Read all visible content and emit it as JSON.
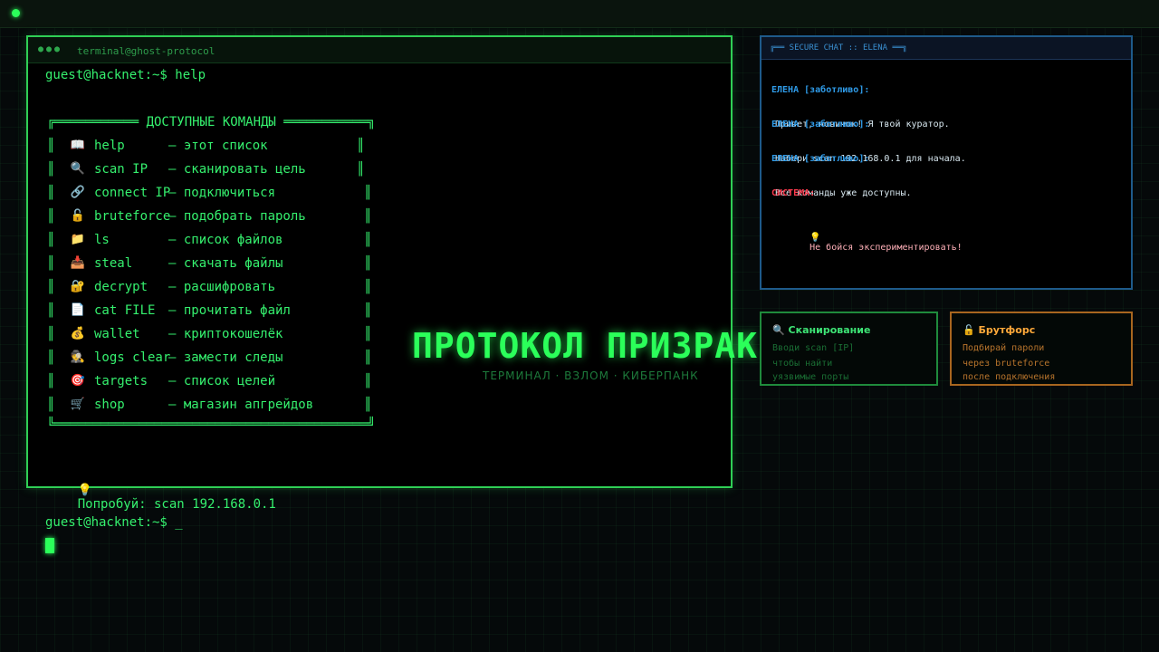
{
  "terminal": {
    "window_title": "terminal@ghost-protocol",
    "prompt": "guest@hacknet:~$ help",
    "box_top": "╔═══════════ ДОСТУПНЫЕ КОМАНДЫ ═══════════╗",
    "box_bottom": "╚═════════════════════════════════════════╝",
    "commands": [
      {
        "icon": "📖",
        "cmd": "help",
        "desc": "— этот список"
      },
      {
        "icon": "🔍",
        "cmd": "scan IP",
        "desc": "— сканировать цель"
      },
      {
        "icon": "🔗",
        "cmd": "connect IP",
        "desc": "— подключиться"
      },
      {
        "icon": "🔓",
        "cmd": "bruteforce",
        "desc": "— подобрать пароль"
      },
      {
        "icon": "📁",
        "cmd": "ls",
        "desc": "— список файлов"
      },
      {
        "icon": "📥",
        "cmd": "steal",
        "desc": "— скачать файлы"
      },
      {
        "icon": "🔐",
        "cmd": "decrypt",
        "desc": "— расшифровать"
      },
      {
        "icon": "📄",
        "cmd": "cat FILE",
        "desc": "— прочитать файл"
      },
      {
        "icon": "💰",
        "cmd": "wallet",
        "desc": "— криптокошелёк"
      },
      {
        "icon": "🕵",
        "cmd": "logs clear",
        "desc": "— замести следы"
      },
      {
        "icon": "🎯",
        "cmd": "targets",
        "desc": "— список целей"
      },
      {
        "icon": "🛒",
        "cmd": "shop",
        "desc": "— магазин апгрейдов"
      }
    ],
    "hint_icon": "💡",
    "hint": "Попробуй: scan 192.168.0.1",
    "input_prompt": "guest@hacknet:~$ _"
  },
  "hero": {
    "title": "ПРОТОКОЛ ПРИЗРАК",
    "subtitle": "ТЕРМИНАЛ · ВЗЛОМ · КИБЕРПАНК"
  },
  "chat": {
    "title": "╔══ SECURE CHAT :: ELENA ══╗",
    "messages": [
      {
        "who": "ЕЛЕНА [заботливо]:",
        "text": "Привет, новичок! Я твой куратор."
      },
      {
        "who": "ЕЛЕНА [заботливо]:",
        "text": "Набери scan 192.168.0.1 для начала."
      },
      {
        "who": "ЕЛЕНА [заботливо]:",
        "text": "Все команды уже доступны."
      },
      {
        "who": "СИСТЕМА:",
        "icon": "💡",
        "text": "Не бойся экспериментировать!"
      }
    ]
  },
  "cards": {
    "scan": {
      "icon": "🔍",
      "title": "Сканирование",
      "lines": [
        "Вводи scan [IP]",
        "чтобы найти",
        "уязвимые порты"
      ]
    },
    "brute": {
      "icon": "🔓",
      "title": "Брутфорс",
      "lines": [
        "Подбирай пароли",
        "через bruteforce",
        "после подключения"
      ]
    }
  },
  "colors": {
    "accent": "#2bff5a",
    "chat_border": "#1e5a8a",
    "brute_accent": "#ffa93a",
    "system": "#ff3b4e"
  }
}
